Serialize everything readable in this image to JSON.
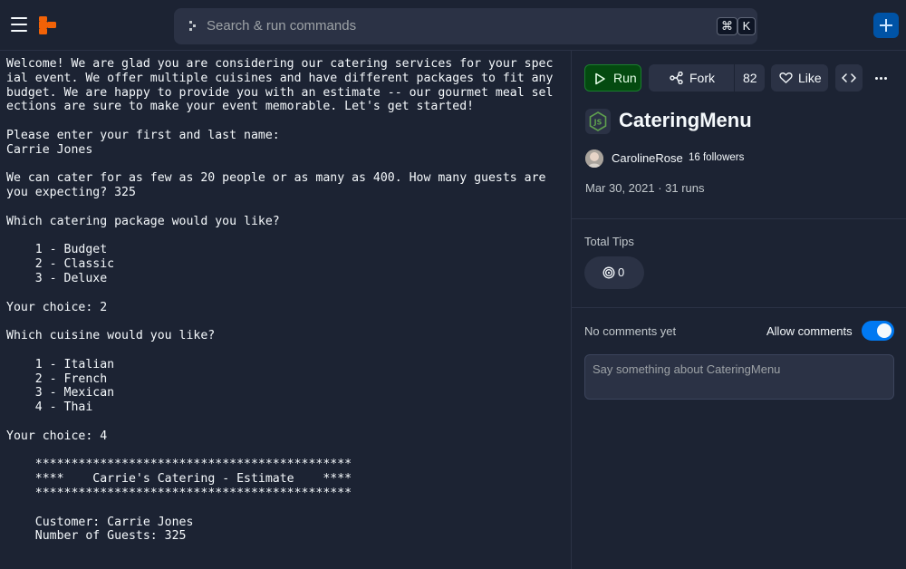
{
  "topbar": {
    "search_placeholder": "Search & run commands",
    "shortcut_key1": "⌘",
    "shortcut_key2": "K"
  },
  "console": {
    "output": "Welcome! We are glad you are considering our catering services for your special event. We offer multiple cuisines and have different packages to fit any budget. We are happy to provide you with an estimate -- our gourmet meal selections are sure to make your event memorable. Let's get started!\n\nPlease enter your first and last name:\nCarrie Jones\n\nWe can cater for as few as 20 people or as many as 400. How many guests are you expecting? 325\n\nWhich catering package would you like?\n\n    1 - Budget\n    2 - Classic\n    3 - Deluxe\n\nYour choice: 2\n\nWhich cuisine would you like?\n\n    1 - Italian\n    2 - French\n    3 - Mexican\n    4 - Thai\n\nYour choice: 4\n\n    ********************************************\n    ****    Carrie's Catering - Estimate    ****\n    ********************************************\n\n    Customer: Carrie Jones\n    Number of Guests: 325"
  },
  "actions": {
    "run_label": "Run",
    "fork_label": "Fork",
    "fork_count": "82",
    "like_label": "Like"
  },
  "repl": {
    "title": "CateringMenu",
    "author": "CarolineRose",
    "followers": "16 followers",
    "meta": "Mar 30, 2021 · 31 runs"
  },
  "tips": {
    "label": "Total Tips",
    "value": "0"
  },
  "comments": {
    "empty_text": "No comments yet",
    "allow_label": "Allow comments",
    "allow_enabled": true,
    "placeholder": "Say something about CateringMenu"
  },
  "colors": {
    "accent": "#0079f2",
    "run_green": "#1a7f2e",
    "logo_orange": "#f26207"
  }
}
